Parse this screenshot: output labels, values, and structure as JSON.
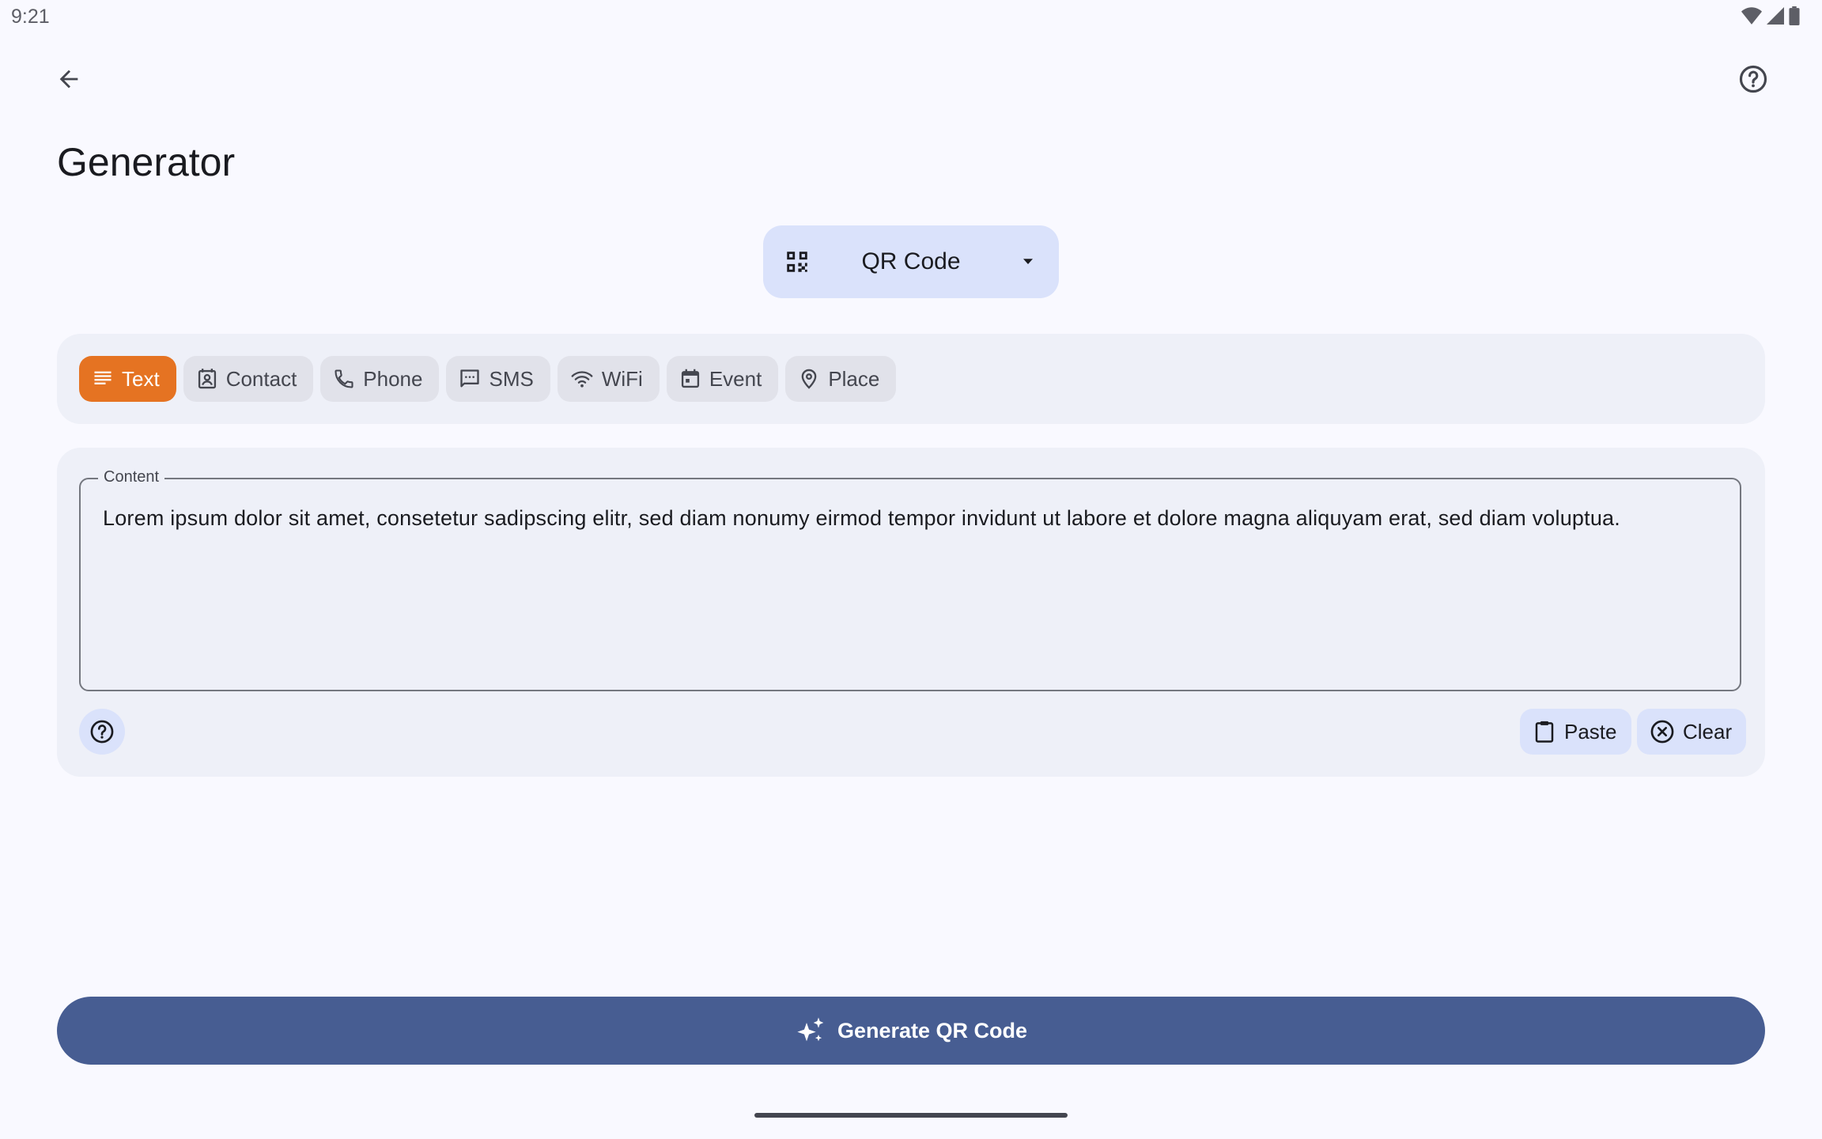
{
  "status_bar": {
    "time": "9:21",
    "icons": [
      "wifi-icon",
      "cell-signal-icon",
      "battery-icon"
    ]
  },
  "top_bar": {
    "back_icon": "arrow-back-icon",
    "help_icon": "help-circle-icon"
  },
  "page": {
    "title": "Generator"
  },
  "code_type_selector": {
    "icon": "qr-code-icon",
    "selected": "QR Code",
    "dropdown_icon": "arrow-drop-down-icon"
  },
  "content_types": {
    "selected": "Text",
    "items": [
      {
        "label": "Text",
        "icon": "notes-icon"
      },
      {
        "label": "Contact",
        "icon": "contact-card-icon"
      },
      {
        "label": "Phone",
        "icon": "phone-icon"
      },
      {
        "label": "SMS",
        "icon": "sms-icon"
      },
      {
        "label": "WiFi",
        "icon": "wifi-icon"
      },
      {
        "label": "Event",
        "icon": "calendar-icon"
      },
      {
        "label": "Place",
        "icon": "place-pin-icon"
      }
    ]
  },
  "content_field": {
    "label": "Content",
    "value": "Lorem ipsum dolor sit amet, consetetur sadipscing elitr, sed diam nonumy eirmod tempor invidunt ut labore et dolore magna aliquyam erat, sed diam voluptua."
  },
  "field_actions": {
    "help_icon": "help-circle-icon",
    "paste_label": "Paste",
    "paste_icon": "clipboard-icon",
    "clear_label": "Clear",
    "clear_icon": "cancel-circle-icon"
  },
  "primary_action": {
    "label": "Generate QR Code",
    "icon": "sparkle-icon"
  },
  "colors": {
    "background": "#f9f9ff",
    "panel": "#eef0f8",
    "selected_chip": "#e57322",
    "tonal": "#dae2fb",
    "primary": "#475d92"
  }
}
